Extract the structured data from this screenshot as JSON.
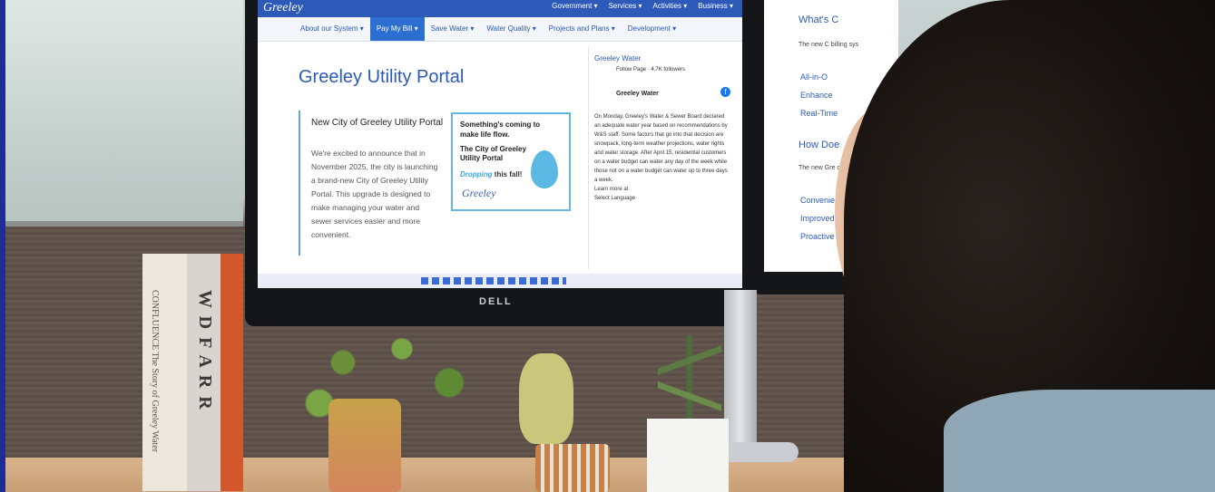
{
  "site": {
    "logo_text": "Greeley",
    "top_nav": [
      "Government ▾",
      "Services ▾",
      "Activities ▾",
      "Business ▾"
    ],
    "sub_nav": [
      {
        "label": "About our System ▾",
        "active": false
      },
      {
        "label": "Pay My Bill ▾",
        "active": true
      },
      {
        "label": "Save Water ▾",
        "active": false
      },
      {
        "label": "Water Quality ▾",
        "active": false
      },
      {
        "label": "Projects and Plans ▾",
        "active": false
      },
      {
        "label": "Development ▾",
        "active": false
      }
    ],
    "page_title": "Greeley Utility Portal",
    "card": {
      "title": "New City of Greeley Utility Portal",
      "body": "We're excited to announce that in November 2025, the city is launching a brand-new City of Greeley Utility Portal. This upgrade is designed to make managing your water and sewer services easier and more convenient."
    },
    "promo": {
      "line1": "Something's coming to make life flow.",
      "line2": "The City of Greeley Utility Portal",
      "dropping": "Dropping",
      "this_fall": "this fall!",
      "logo": "Greeley"
    },
    "sidebar": {
      "header": "Greeley Water",
      "follow": "Follow Page · 4.7K followers",
      "post_name": "Greeley Water",
      "post_text": "On Monday, Greeley's Water & Sewer Board declared an adequate water year based on recommendations by W&S staff. Some factors that go into that decision are snowpack, long-term weather projections, water rights and water storage. After April 15, residential customers on a water budget can water any day of the week while those not on a water budget can water up to three days a week.",
      "learn_more": "Learn more at",
      "select_language": "Select Language"
    }
  },
  "monitor_brand": "DELL",
  "second_screen": {
    "heading1": "What's C",
    "text1": "The new C billing sys",
    "items1": [
      "All-in-O",
      "Enhance",
      "Real-Time"
    ],
    "heading2": "How Doe",
    "text2": "The new Gre current syster",
    "items2": [
      "Convenien",
      "Improved Se",
      "Proactive Wa"
    ]
  },
  "books": {
    "book1_spine": "CONFLUENCE The Story of Greeley Water",
    "book2_spine": "W D F A R R"
  }
}
